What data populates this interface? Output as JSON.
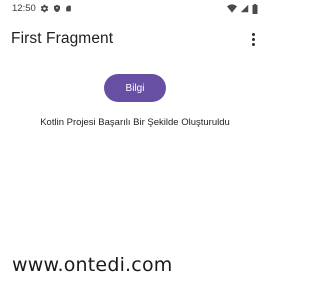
{
  "status_bar": {
    "time": "12:50",
    "left_icons": [
      "settings-icon",
      "shield-icon",
      "sim-card-icon"
    ],
    "right_icons": [
      "wifi-icon",
      "cellular-signal-icon",
      "battery-icon"
    ]
  },
  "app_bar": {
    "title": "First Fragment",
    "overflow_icon": "more-vert-icon"
  },
  "main": {
    "button_label": "Bilgi",
    "message": "Kotlin Projesi Başarılı Bir Şekilde Oluşturuldu"
  },
  "watermark": {
    "text": "www.ontedi.com"
  },
  "colors": {
    "accent": "#6750a4",
    "background": "#ffffff",
    "text": "#1f1f1f"
  }
}
